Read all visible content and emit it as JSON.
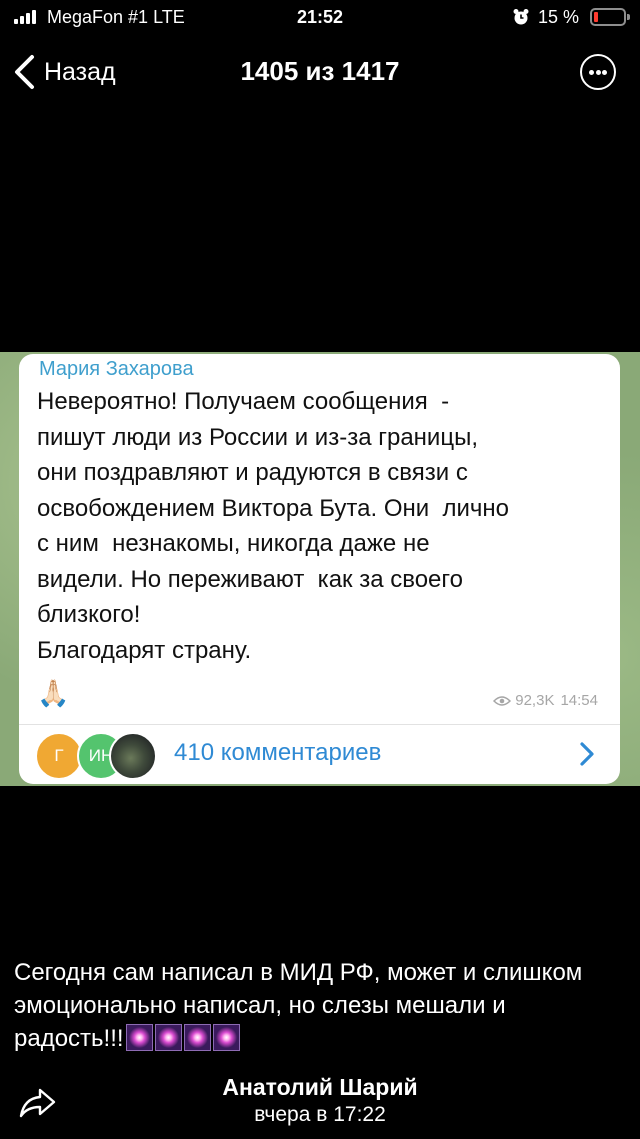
{
  "status_bar": {
    "carrier": "MegaFon #1  LTE",
    "time": "21:52",
    "battery_percent": "15 %",
    "battery_level": 0.15,
    "alarm_icon": "alarm-clock-icon"
  },
  "nav": {
    "back_label": "Назад",
    "title": "1405 из 1417",
    "more_icon": "more-dots-icon"
  },
  "post": {
    "author": "Мария Захарова",
    "text": "Невероятно! Получаем сообщения  -\nпишут люди из России и из-за границы,\nони поздравляют и радуются в связи с\nосвобождением Виктора Бута. Они  лично\nс ним  незнакомы, никогда даже не\nвидели. Но переживают  как за своего\nблизкого!\nБлагодарят страну.",
    "emoji": "🙏🏻",
    "views": "92,3K",
    "time": "14:54",
    "comment_avatars": [
      "Г",
      "ИН",
      ""
    ],
    "comments_label": "410 комментариев"
  },
  "caption": {
    "text": "Сегодня сам написал в МИД РФ, может и слишком эмоционально написал, но слезы мешали и радость!!!"
  },
  "footer": {
    "name": "Анатолий Шарий",
    "time": "вчера в 17:22",
    "share_icon": "share-icon"
  },
  "colors": {
    "background": "#000000",
    "author_name": "#3f9fcd",
    "link": "#2f8ad4",
    "battery_low": "#ff3b30"
  }
}
